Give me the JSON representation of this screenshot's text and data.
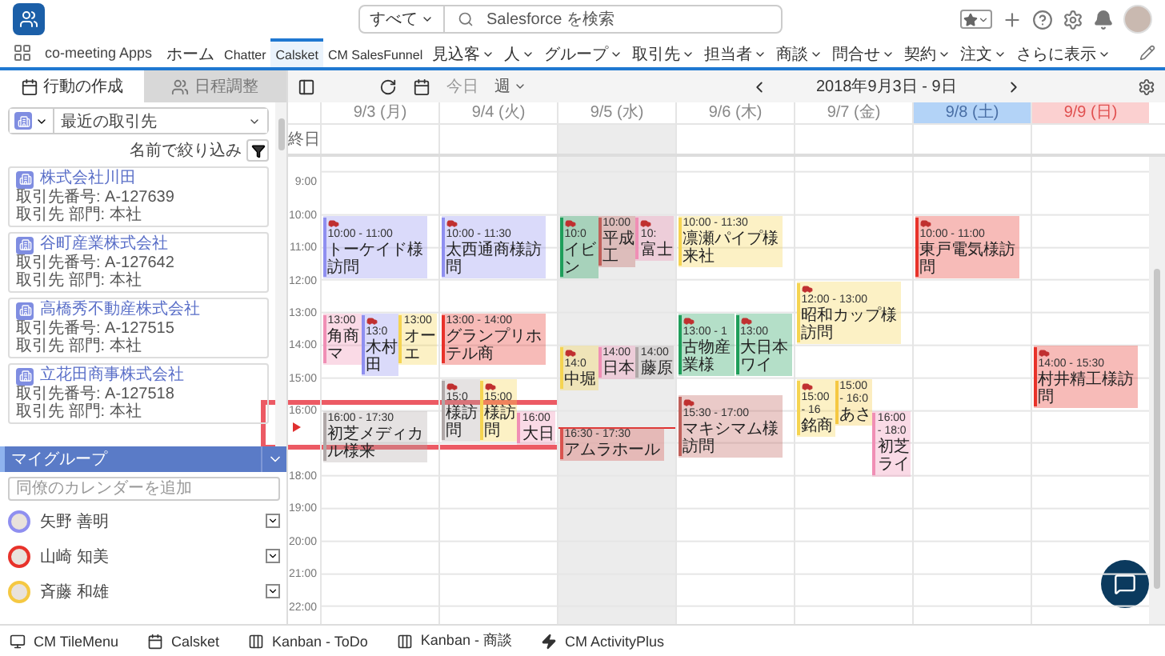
{
  "header": {
    "search_scope": "すべて",
    "search_placeholder": "Salesforce を検索"
  },
  "nav": {
    "app_name": "co-meeting Apps",
    "more": "さらに表示",
    "items": [
      {
        "label": "ホーム",
        "dropdown": false,
        "selected": false
      },
      {
        "label": "Chatter",
        "dropdown": false,
        "selected": false
      },
      {
        "label": "Calsket",
        "dropdown": false,
        "selected": true
      },
      {
        "label": "CM SalesFunnel",
        "dropdown": false,
        "selected": false
      },
      {
        "label": "見込客",
        "dropdown": true,
        "selected": false
      },
      {
        "label": "人",
        "dropdown": true,
        "selected": false
      },
      {
        "label": "グループ",
        "dropdown": true,
        "selected": false
      },
      {
        "label": "取引先",
        "dropdown": true,
        "selected": false
      },
      {
        "label": "担当者",
        "dropdown": true,
        "selected": false
      },
      {
        "label": "商談",
        "dropdown": true,
        "selected": false
      },
      {
        "label": "問合せ",
        "dropdown": true,
        "selected": false
      },
      {
        "label": "契約",
        "dropdown": true,
        "selected": false
      },
      {
        "label": "注文",
        "dropdown": true,
        "selected": false
      }
    ]
  },
  "sidebar": {
    "tabs": [
      {
        "label": "行動の作成",
        "kind": "calendar",
        "selected": true
      },
      {
        "label": "日程調整",
        "kind": "people",
        "selected": false
      }
    ],
    "source_select": "最近の取引先",
    "filter_label": "名前で絞り込み",
    "accounts": [
      {
        "name": "株式会社川田",
        "number": "取引先番号: A-127639",
        "department": "取引先 部門: 本社"
      },
      {
        "name": "谷町産業株式会社",
        "number": "取引先番号: A-127642",
        "department": "取引先 部門: 本社"
      },
      {
        "name": "高橋秀不動産株式会社",
        "number": "取引先番号: A-127515",
        "department": "取引先 部門: 本社"
      },
      {
        "name": "立花田商事株式会社",
        "number": "取引先番号: A-127518",
        "department": "取引先 部門: 本社"
      }
    ],
    "group": {
      "title": "マイグループ",
      "add_placeholder": "同僚のカレンダーを追加",
      "members": [
        {
          "name": "矢野 善明",
          "color": "#8f8ff0"
        },
        {
          "name": "山崎 知美",
          "color": "#e8322a"
        },
        {
          "name": "斉藤 和雄",
          "color": "#f5c842"
        }
      ]
    }
  },
  "calendar": {
    "today_button": "今日",
    "view": "週",
    "range": "2018年9月3日 - 9日",
    "all_day_label": "終日",
    "hours": [
      "9:00",
      "10:00",
      "11:00",
      "12:00",
      "13:00",
      "14:00",
      "15:00",
      "16:00",
      "18:00",
      "19:00",
      "20:00",
      "21:00",
      "22:00"
    ],
    "days": [
      {
        "label": "9/3 (月)",
        "kind": "weekday",
        "today": false,
        "events": [
          {
            "time": "10:00 - 11:00",
            "title": "トーケイド様訪問",
            "car": true,
            "color": "#8f8ff0"
          },
          {
            "time": "13:00",
            "title": "角商マ",
            "car": false,
            "color": "#f08fb5"
          },
          {
            "time": "13:0",
            "title": "木村田",
            "car": true,
            "color": "#8f8ff0"
          },
          {
            "time": "13:00",
            "title": "オーエ",
            "car": false,
            "color": "#f5d451"
          },
          {
            "time": "16:00 - 17:30",
            "title": "初芝メディカル様来",
            "car": false,
            "color": "#b0a8a8"
          }
        ]
      },
      {
        "label": "9/4 (火)",
        "kind": "weekday",
        "today": false,
        "events": [
          {
            "time": "10:00 - 11:30",
            "title": "太西通商様訪問",
            "car": true,
            "color": "#8f8ff0"
          },
          {
            "time": "13:00 - 14:00",
            "title": "グランプリホテル商",
            "car": false,
            "color": "#e8322a"
          },
          {
            "time": "15:0",
            "title": "様訪問",
            "car": true,
            "color": "#b0a8a8"
          },
          {
            "time": "15:00",
            "title": "様訪問",
            "car": true,
            "color": "#f5d451"
          },
          {
            "time": "16:00",
            "title": "大日",
            "car": false,
            "color": "#f08fb5"
          }
        ]
      },
      {
        "label": "9/5 (水)",
        "kind": "weekday",
        "today": true,
        "events": [
          {
            "time": "10:0",
            "title": "イビン",
            "car": true,
            "color": "#1e9e5a"
          },
          {
            "time": "10:00",
            "title": "平成工",
            "car": false,
            "color": "#c0605a"
          },
          {
            "time": "10:",
            "title": "富士",
            "car": true,
            "color": "#f08fb5"
          },
          {
            "time": "14:0",
            "title": "中堀",
            "car": true,
            "color": "#f5d451"
          },
          {
            "time": "14:00",
            "title": "日本",
            "car": false,
            "color": "#f08fb5"
          },
          {
            "time": "14:00",
            "title": "藤原",
            "car": false,
            "color": "#b0a8a8"
          },
          {
            "time": "16:30 - 17:30",
            "title": "アムラホール",
            "car": false,
            "color": "#d9534f"
          }
        ]
      },
      {
        "label": "9/6 (木)",
        "kind": "weekday",
        "today": false,
        "events": [
          {
            "time": "10:00 - 11:30",
            "title": "凛瀬パイプ様来社",
            "car": false,
            "color": "#f5d451"
          },
          {
            "time": "13:00 - 1",
            "title": "古物産業様",
            "car": true,
            "color": "#1e9e5a"
          },
          {
            "time": "13:00",
            "title": "大日本ワイ",
            "car": true,
            "color": "#1e9e5a"
          },
          {
            "time": "15:30 - 17:00",
            "title": "マキシマム様訪問",
            "car": true,
            "color": "#c0605a"
          }
        ]
      },
      {
        "label": "9/7 (金)",
        "kind": "weekday",
        "today": false,
        "events": [
          {
            "time": "12:00 - 13:00",
            "title": "昭和カップ様訪問",
            "car": true,
            "color": "#f5d451"
          },
          {
            "time": "15:00 - 16",
            "title": "銘商",
            "car": true,
            "color": "#f5d451"
          },
          {
            "time": "15:00 - 16:0",
            "title": "あさ",
            "car": false,
            "color": "#f5c842"
          },
          {
            "time": "16:00 - 18:0",
            "title": "初芝ライ",
            "car": false,
            "color": "#f08fb5"
          }
        ]
      },
      {
        "label": "9/8 (土)",
        "kind": "saturday",
        "today": false,
        "events": [
          {
            "time": "10:00 - 11:00",
            "title": "東戸電気様訪問",
            "car": true,
            "color": "#e8322a"
          }
        ]
      },
      {
        "label": "9/9 (日)",
        "kind": "sunday",
        "today": false,
        "events": [
          {
            "time": "14:00 - 15:30",
            "title": "村井精工様訪問",
            "car": true,
            "color": "#e8322a"
          }
        ]
      }
    ]
  },
  "annotation": {
    "kind": "highlight_frame"
  },
  "bottom_bar": {
    "items": [
      {
        "label": "CM TileMenu",
        "kind": "monitor"
      },
      {
        "label": "Calsket",
        "kind": "calendar"
      },
      {
        "label": "Kanban - ToDo",
        "kind": "kanban"
      },
      {
        "label": "Kanban - 商談",
        "kind": "kanban"
      },
      {
        "label": "CM ActivityPlus",
        "kind": "bolt"
      }
    ]
  }
}
